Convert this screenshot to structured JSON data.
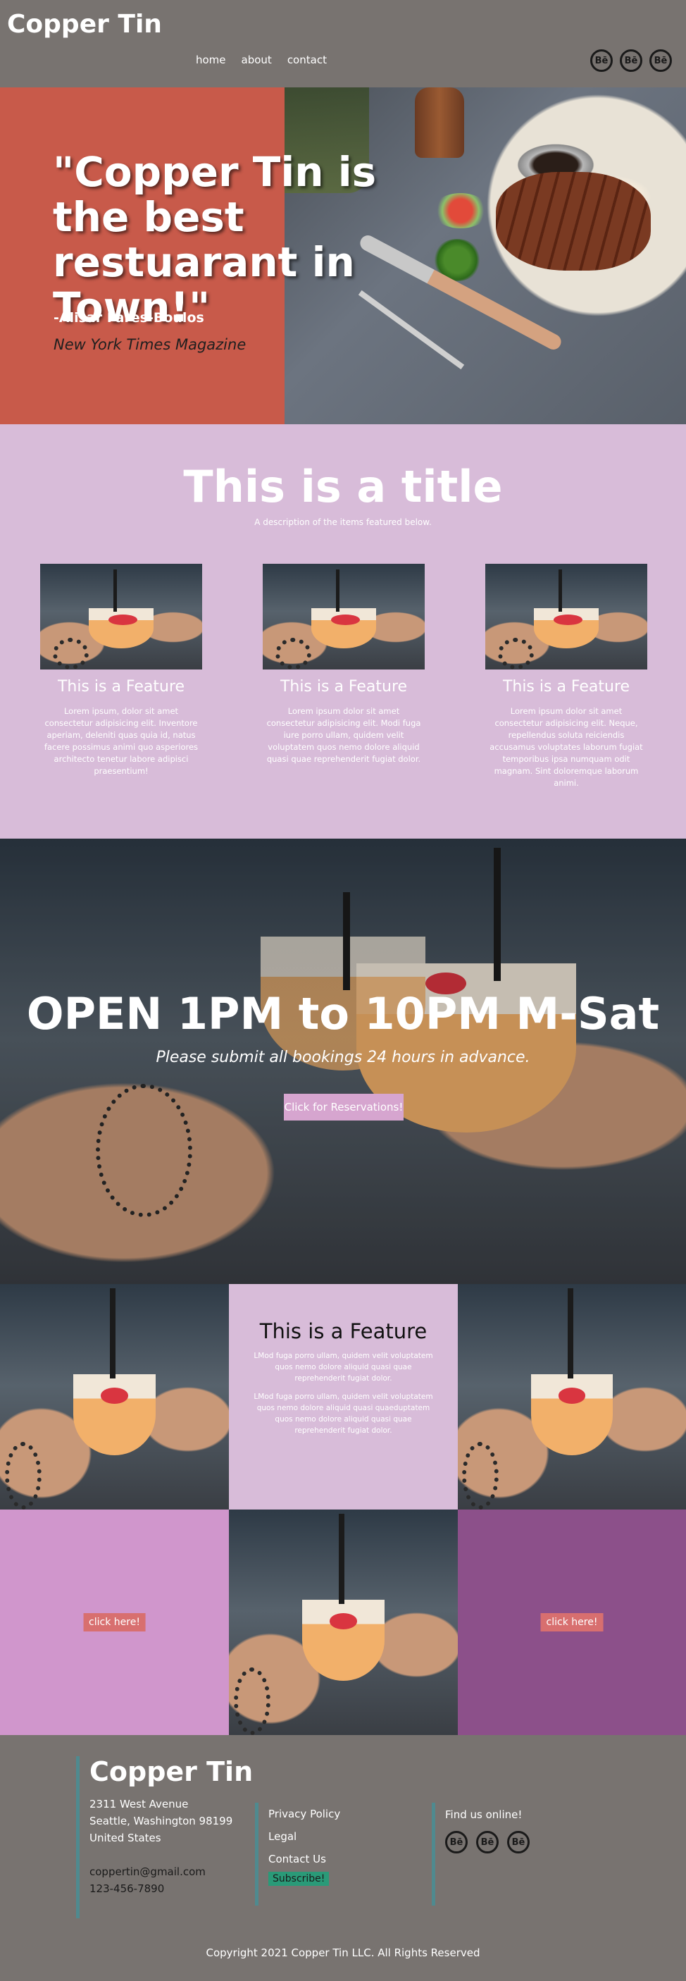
{
  "nav": {
    "brand": "Copper Tin",
    "links": [
      "home",
      "about",
      "contact"
    ],
    "social": [
      "Bē",
      "Bē",
      "Bē"
    ]
  },
  "hero": {
    "quote": "\"Copper Tin is the best restuarant in Town!\"",
    "author": "-Alisar Fares-Boulos",
    "source": "New York Times Magazine"
  },
  "features": {
    "title": "This is a title",
    "description": "A description of the items featured below.",
    "cards": [
      {
        "title": "This is a Feature",
        "text": "Lorem ipsum, dolor sit amet consectetur adipisicing elit. Inventore aperiam, deleniti quas quia id, natus facere possimus animi quo asperiores architecto tenetur labore adipisci praesentium!"
      },
      {
        "title": "This is a Feature",
        "text": "Lorem ipsum dolor sit amet consectetur adipisicing elit. Modi fuga iure porro ullam, quidem velit voluptatem quos nemo dolore aliquid quasi quae reprehenderit fugiat dolor."
      },
      {
        "title": "This is a Feature",
        "text": "Lorem ipsum dolor sit amet consectetur adipisicing elit. Neque, repellendus soluta reiciendis accusamus voluptates laborum fugiat temporibus ipsa numquam odit magnam. Sint doloremque laborum animi."
      }
    ]
  },
  "hours": {
    "title": "OPEN 1PM to 10PM M-Sat",
    "subtitle": "Please submit all bookings 24 hours in advance.",
    "button": "Click for Reservations!"
  },
  "grid": {
    "feature_title": "This is a Feature",
    "feature_p1": "LMod fuga porro ullam, quidem velit voluptatem quos nemo dolore aliquid quasi quae reprehenderit fugiat dolor.",
    "feature_p2": "LMod fuga porro ullam, quidem velit voluptatem quos nemo dolore aliquid quasi quaeduptatem quos nemo dolore aliquid quasi quae reprehenderit fugiat dolor.",
    "click_left": "click here!",
    "click_right": "click here!"
  },
  "footer": {
    "brand": "Copper Tin",
    "address1": "2311 West Avenue",
    "address2": "Seattle, Washington 98199",
    "address3": "United States",
    "email": "coppertin@gmail.com",
    "phone": "123-456-7890",
    "links": [
      "Privacy Policy",
      "Legal",
      "Contact Us"
    ],
    "subscribe": "Subscribe!",
    "online": "Find us online!",
    "social": [
      "Bē",
      "Bē",
      "Bē"
    ],
    "copyright": "Copyright 2021 Copper Tin LLC. All Rights Reserved"
  },
  "colors": {
    "nav_bg": "#787370",
    "hero_red": "#c85a4a",
    "lavender": "#d8bcd9",
    "pink": "#d096cc",
    "purple": "#8c508a",
    "accent_teal": "#4f8a8f",
    "subscribe_green": "#2a9a78"
  }
}
